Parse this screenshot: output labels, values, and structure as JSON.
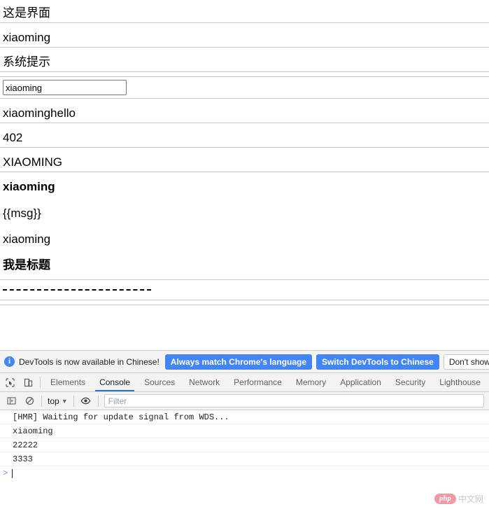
{
  "page": {
    "rows": [
      {
        "text": "这是界面",
        "bold": false,
        "sep_after": true
      },
      {
        "text": "xiaoming",
        "bold": false,
        "sep_after": true
      },
      {
        "text": "系统提示",
        "bold": false,
        "sep_after": true
      },
      {
        "text": "xiaominghello",
        "bold": false,
        "sep_after": true
      },
      {
        "text": "402",
        "bold": false,
        "sep_after": true
      },
      {
        "text": "XIAOMING",
        "bold": false,
        "sep_after": true
      },
      {
        "text": "xiaoming",
        "bold": true,
        "sep_after": false
      },
      {
        "text": "{{msg}}",
        "bold": false,
        "sep_after": false
      },
      {
        "text": "xiaoming",
        "bold": false,
        "sep_after": false
      },
      {
        "text": "我是标题",
        "bold": true,
        "sep_after": true
      }
    ],
    "input": {
      "value": "xiaoming",
      "placeholder": ""
    },
    "dashed_divider": "----------------------------"
  },
  "devtools": {
    "notification": {
      "icon": "info-icon",
      "message": "DevTools is now available in Chinese!",
      "primary_button": "Always match Chrome's language",
      "secondary_button": "Switch DevTools to Chinese",
      "dismiss_button": "Don't show again",
      "accent_color": "#4285f4"
    },
    "tabs": [
      {
        "label": "Elements",
        "active": false
      },
      {
        "label": "Console",
        "active": true
      },
      {
        "label": "Sources",
        "active": false
      },
      {
        "label": "Network",
        "active": false
      },
      {
        "label": "Performance",
        "active": false
      },
      {
        "label": "Memory",
        "active": false
      },
      {
        "label": "Application",
        "active": false
      },
      {
        "label": "Security",
        "active": false
      },
      {
        "label": "Lighthouse",
        "active": false
      }
    ],
    "active_tab_underline_color": "#1a73e8",
    "console_toolbar": {
      "sidebar_toggle_icon": "sidebar-toggle-icon",
      "clear_console_icon": "clear-console-icon",
      "context": "top",
      "context_caret": "▼",
      "live_expression_icon": "eye-icon",
      "filter_placeholder": "Filter",
      "filter_value": ""
    },
    "console_messages": [
      "[HMR] Waiting for update signal from WDS...",
      "xiaoming",
      "22222",
      "3333"
    ],
    "prompt_symbol": ">"
  },
  "watermark": {
    "badge": "php",
    "text": "中文网",
    "badge_color": "#e8435a"
  }
}
